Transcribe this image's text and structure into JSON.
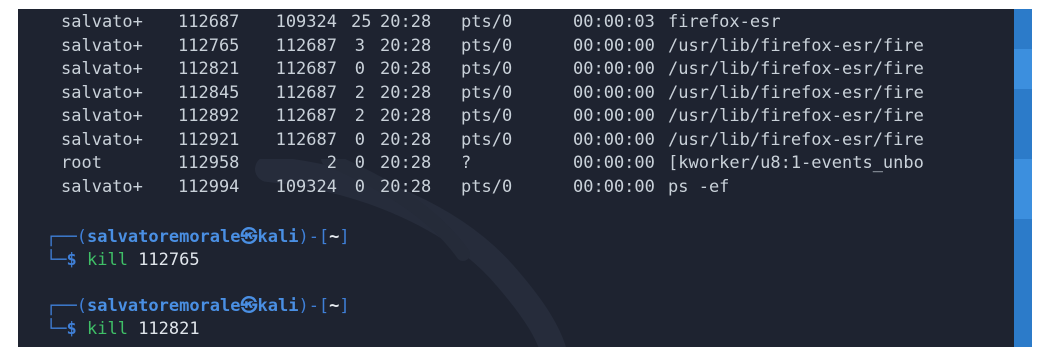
{
  "process_rows": [
    {
      "uid": "salvato+",
      "pid": "112687",
      "ppid": "109324",
      "c": "25",
      "stime": "20:28",
      "tty": "pts/0",
      "time": "00:00:03",
      "cmd": "firefox-esr"
    },
    {
      "uid": "salvato+",
      "pid": "112765",
      "ppid": "112687",
      "c": "3",
      "stime": "20:28",
      "tty": "pts/0",
      "time": "00:00:00",
      "cmd": "/usr/lib/firefox-esr/fire"
    },
    {
      "uid": "salvato+",
      "pid": "112821",
      "ppid": "112687",
      "c": "0",
      "stime": "20:28",
      "tty": "pts/0",
      "time": "00:00:00",
      "cmd": "/usr/lib/firefox-esr/fire"
    },
    {
      "uid": "salvato+",
      "pid": "112845",
      "ppid": "112687",
      "c": "2",
      "stime": "20:28",
      "tty": "pts/0",
      "time": "00:00:00",
      "cmd": "/usr/lib/firefox-esr/fire"
    },
    {
      "uid": "salvato+",
      "pid": "112892",
      "ppid": "112687",
      "c": "2",
      "stime": "20:28",
      "tty": "pts/0",
      "time": "00:00:00",
      "cmd": "/usr/lib/firefox-esr/fire"
    },
    {
      "uid": "salvato+",
      "pid": "112921",
      "ppid": "112687",
      "c": "0",
      "stime": "20:28",
      "tty": "pts/0",
      "time": "00:00:00",
      "cmd": "/usr/lib/firefox-esr/fire"
    },
    {
      "uid": "root",
      "pid": "112958",
      "ppid": "2",
      "c": "0",
      "stime": "20:28",
      "tty": "?",
      "time": "00:00:00",
      "cmd": "[kworker/u8:1-events_unbo"
    },
    {
      "uid": "salvato+",
      "pid": "112994",
      "ppid": "109324",
      "c": "0",
      "stime": "20:28",
      "tty": "pts/0",
      "time": "00:00:00",
      "cmd": "ps -ef"
    }
  ],
  "prompts": [
    {
      "frame_top": "┌──",
      "open_paren": "(",
      "user": "salvatoremorale",
      "at": "㉿",
      "host": "kali",
      "close_paren": ")-[",
      "cwd": "~",
      "close_bracket": "]",
      "frame_bottom": "└─",
      "dollar": "$",
      "command": "kill",
      "argument": "112765"
    },
    {
      "frame_top": "┌──",
      "open_paren": "(",
      "user": "salvatoremorale",
      "at": "㉿",
      "host": "kali",
      "close_paren": ")-[",
      "cwd": "~",
      "close_bracket": "]",
      "frame_bottom": "└─",
      "dollar": "$",
      "command": "kill",
      "argument": "112821"
    }
  ],
  "colors": {
    "terminal_bg": "#1e2330",
    "text": "#c9d1d9",
    "prompt_blue": "#4a8fe3",
    "command_green": "#3fbf67",
    "accent_blue": "#2c7bc9"
  },
  "background_logo": "kali-dragon-icon"
}
